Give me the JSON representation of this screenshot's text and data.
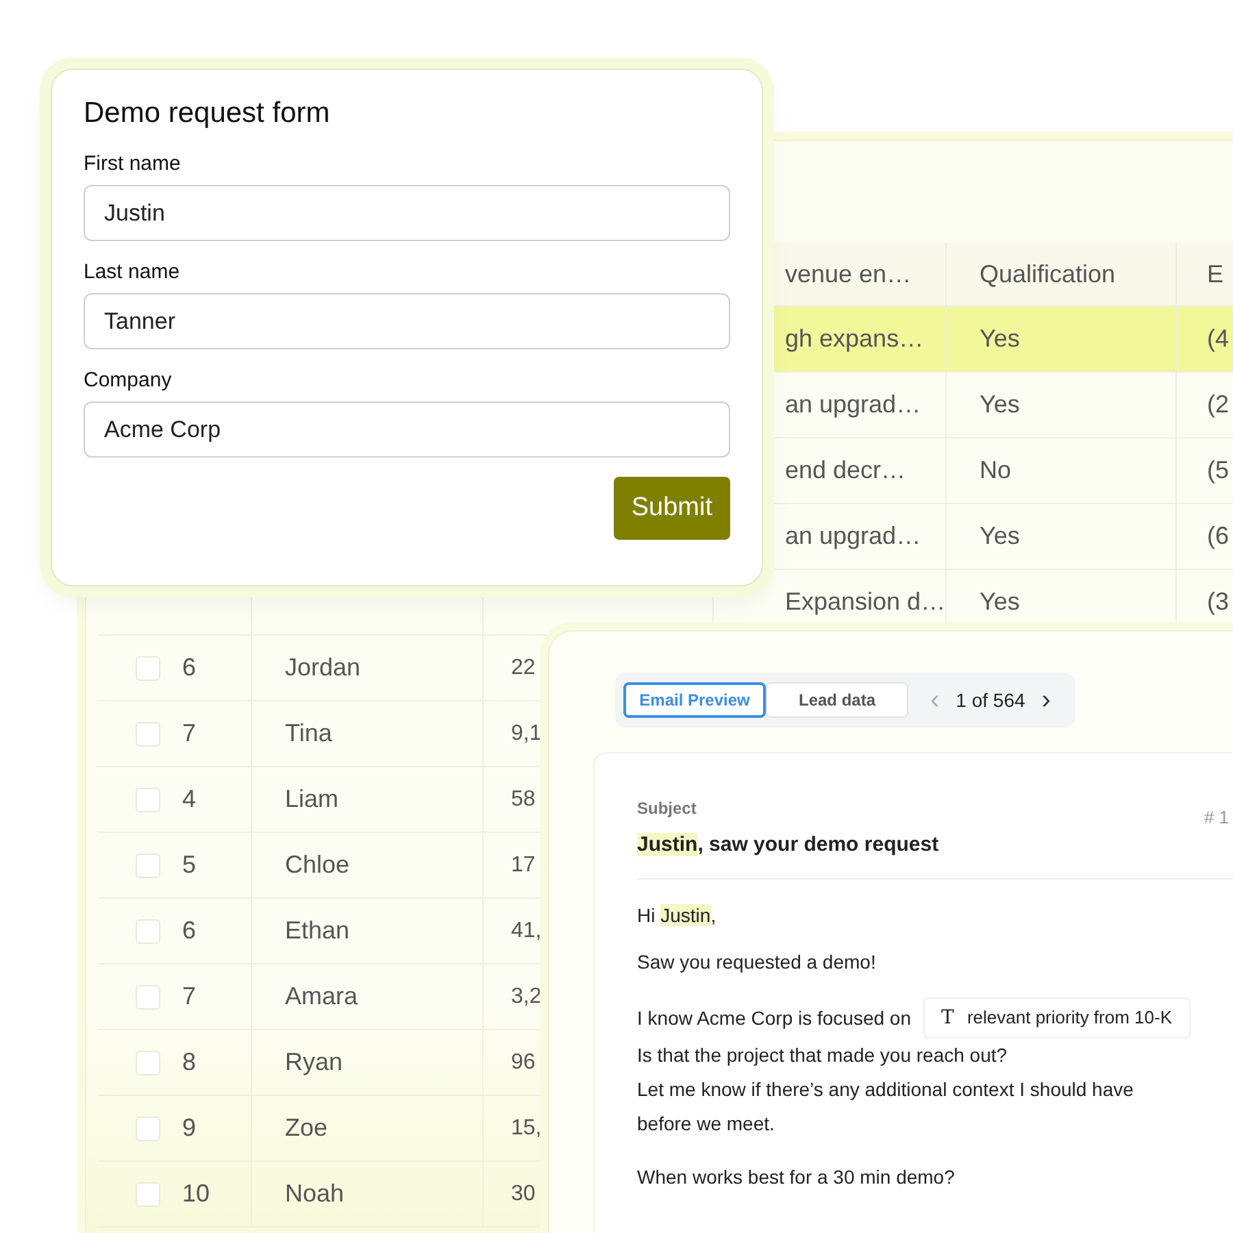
{
  "table": {
    "columns": [
      {
        "label": "venue en…"
      },
      {
        "label": "Qualification"
      },
      {
        "label": "E"
      }
    ],
    "rows": [
      {
        "revenue": "gh expans…",
        "qualification": "Yes",
        "column_6": "(4",
        "selected": true
      },
      {
        "revenue": "an upgrad…",
        "qualification": "Yes",
        "column_6": "(2",
        "selected": false
      },
      {
        "revenue": "end decr…",
        "qualification": "No",
        "column_6": "(5",
        "selected": false
      },
      {
        "revenue": "an upgrad…",
        "qualification": "Yes",
        "column_6": "(6",
        "selected": false
      },
      {
        "revenue": "Expansion d…",
        "qualification": "Yes",
        "column_6": "(3",
        "selected": false
      },
      {
        "number": "6",
        "name": "Jordan",
        "column_3": "22",
        "checked": false,
        "selected": false
      },
      {
        "number": "7",
        "name": "Tina",
        "column_3": "9,1",
        "checked": false,
        "selected": false
      },
      {
        "number": "4",
        "name": "Liam",
        "column_3": "58",
        "checked": false,
        "selected": false
      },
      {
        "number": "5",
        "name": "Chloe",
        "column_3": "17",
        "checked": false,
        "selected": false
      },
      {
        "number": "6",
        "name": "Ethan",
        "column_3": "41,",
        "checked": false,
        "selected": false
      },
      {
        "number": "7",
        "name": "Amara",
        "column_3": "3,2",
        "checked": false,
        "selected": false
      },
      {
        "number": "8",
        "name": "Ryan",
        "column_3": "96",
        "checked": false,
        "selected": false
      },
      {
        "number": "9",
        "name": "Zoe",
        "column_3": "15,",
        "checked": false,
        "selected": false
      },
      {
        "number": "10",
        "name": "Noah",
        "column_3": "30",
        "checked": false,
        "selected": false
      }
    ]
  },
  "form": {
    "title": "Demo request form",
    "fields": [
      {
        "label": "First name",
        "value": "Justin"
      },
      {
        "label": "Last name",
        "value": "Tanner"
      },
      {
        "label": "Company",
        "value": "Acme Corp"
      }
    ],
    "submit": "Submit"
  },
  "email": {
    "tabs": [
      {
        "label": "Email Preview",
        "selected": true
      },
      {
        "label": "Lead data",
        "selected": false
      }
    ],
    "pager": {
      "prev": "‹",
      "text": "1 of 564",
      "next": "›"
    },
    "subject_label": "Subject",
    "counter": "# 1",
    "subject": {
      "name": "Justin",
      "rest": ", saw your demo request"
    },
    "greeting": {
      "before": "Hi ",
      "name": "Justin",
      "after": ","
    },
    "lines": [
      {
        "kind": "text",
        "text": "Saw you requested a demo!"
      },
      {
        "kind": "chip",
        "text": "I know Acme Corp is focused on",
        "chip_icon": "T",
        "chip": "relevant priority from 10-K"
      },
      {
        "kind": "tight",
        "text": "Is that the project that made you reach out?"
      },
      {
        "kind": "tight",
        "text": "Let me know if there’s any additional context I should have before we meet."
      },
      {
        "kind": "text",
        "text": "When works best for a 30 min demo?"
      }
    ]
  }
}
